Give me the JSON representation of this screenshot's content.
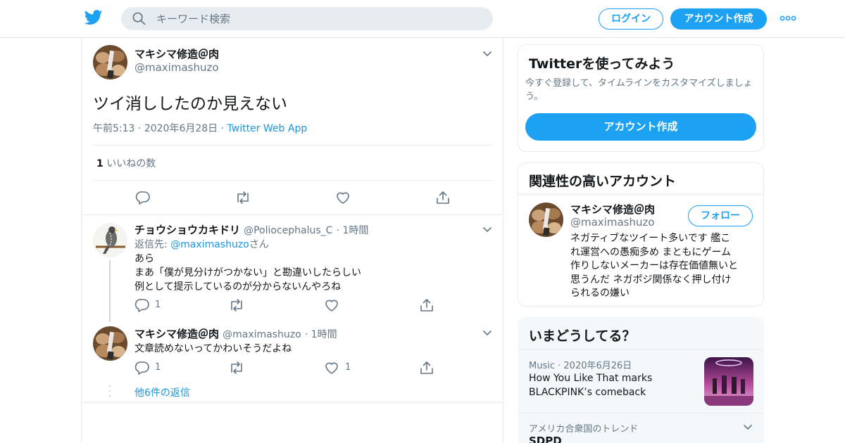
{
  "header": {
    "search_placeholder": "キーワード検索",
    "login_label": "ログイン",
    "signup_label": "アカウント作成"
  },
  "tweet": {
    "author_name": "マキシマ修造＠肉",
    "author_handle": "@maximashuzo",
    "text": "ツイ消ししたのか見えない",
    "time": "午前5:13",
    "date": "2020年6月28日",
    "source": "Twitter Web App",
    "like_count": "1",
    "like_label": "いいねの数"
  },
  "replies": [
    {
      "author_name": "チョウショウカキドリ",
      "author_handle": "@Poliocephalus_C",
      "time": "1時間",
      "reply_to_prefix": "返信先: ",
      "reply_to_handle": "@maximashuzo",
      "reply_to_suffix": "さん",
      "lines": [
        "あら",
        "まあ「僕が見分けがつかない」と勘違いしたらしい",
        "例として提示しているのが分からないんやろね"
      ],
      "reply_count": "1",
      "retweet_count": "",
      "like_count": ""
    },
    {
      "author_name": "マキシマ修造＠肉",
      "author_handle": "@maximashuzo",
      "time": "1時間",
      "text": "文章読めないってかわいそうだよね",
      "reply_count": "1",
      "retweet_count": "",
      "like_count": "1"
    }
  ],
  "more_replies": "他6件の返信",
  "signup_card": {
    "title": "Twitterを使ってみよう",
    "text_line1": "今すぐ登録して、タイムラインをカスタマイズしましょ",
    "text_line2": "う。",
    "button": "アカウント作成"
  },
  "related_card": {
    "title": "関連性の高いアカウント",
    "name": "マキシマ修造＠肉",
    "handle": "@maximashuzo",
    "follow_label": "フォロー",
    "bio_lines": [
      "ネガティブなツイート多いです 艦こ",
      "れ運営への愚痴多め まともにゲーム",
      "作りしないメーカーは存在価値無いと",
      "思うんだ ネガポジ関係なく押し付け",
      "られるの嫌い"
    ]
  },
  "trends_card": {
    "title": "いまどうしてる？",
    "item1_category": "Music",
    "item1_date": "2020年6月26日",
    "item1_line1": "How You Like That marks",
    "item1_line2": "BLACKPINK’s comeback",
    "item2_context": "アメリカ合衆国のトレンド",
    "item2_name": "SDPD"
  },
  "colors": {
    "accent": "#1da1f2",
    "link": "#1b95e0",
    "secondary_text": "#657786",
    "border": "#e6ecf0"
  },
  "icons": [
    "twitter-bird-icon",
    "search-icon",
    "more-icon",
    "chevron-down-icon",
    "reply-icon",
    "retweet-icon",
    "like-icon",
    "share-icon"
  ]
}
